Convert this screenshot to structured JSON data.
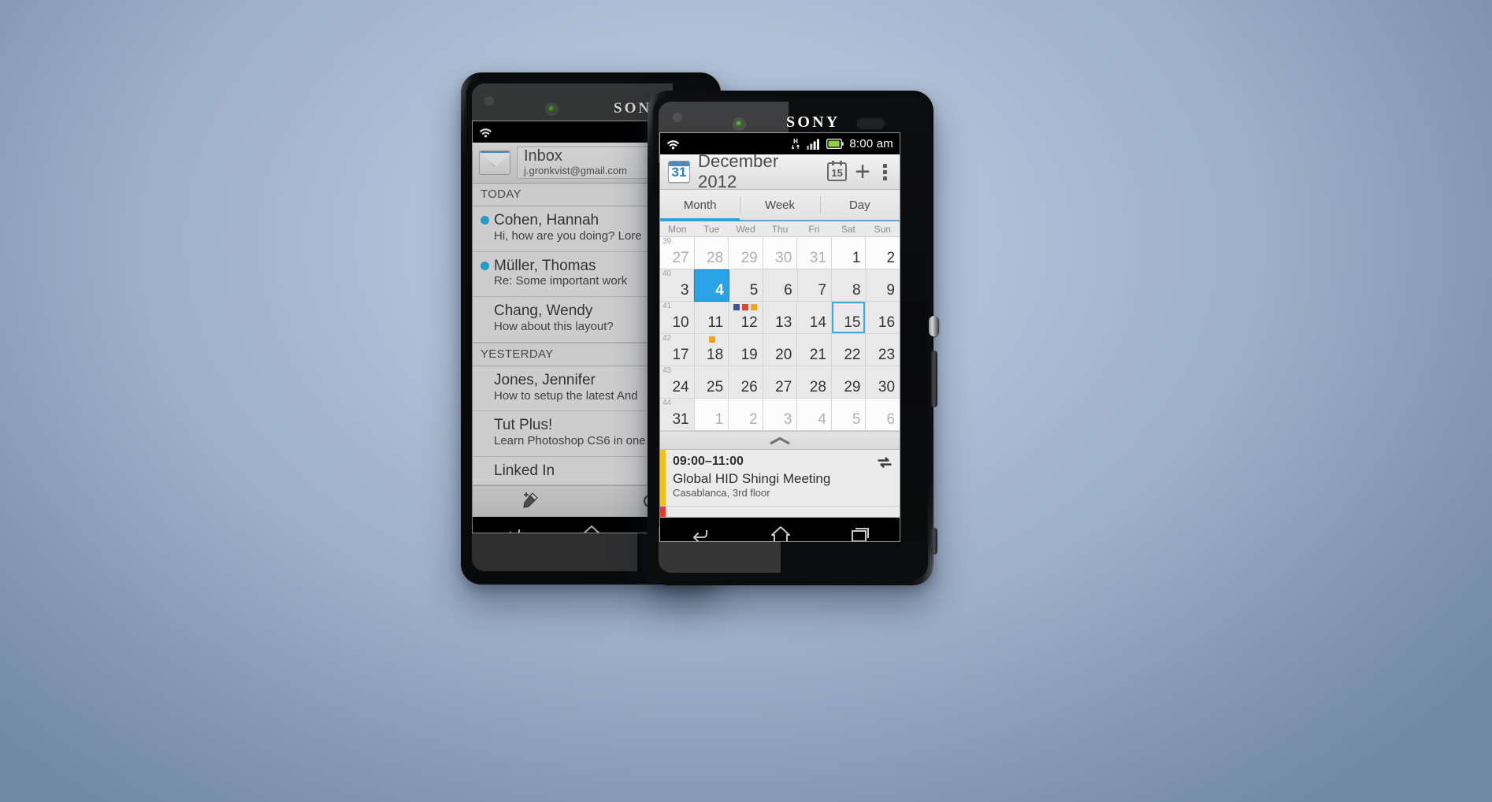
{
  "background": {
    "color_center": "#b6c6dc",
    "color_edge": "#7289a5"
  },
  "brand": {
    "logo": "SONY"
  },
  "mail_phone": {
    "statusbar": {
      "wifi_icon": "wifi-icon"
    },
    "header": {
      "icon": "mail-icon",
      "title": "Inbox",
      "account": "j.gronkvist@gmail.com"
    },
    "sections": [
      {
        "label": "TODAY",
        "rows": [
          {
            "from": "Cohen, Hannah",
            "snippet": "Hi, how are you doing? Lore",
            "unread": true
          },
          {
            "from": "Müller, Thomas",
            "snippet": "Re: Some important work",
            "unread": true
          },
          {
            "from": "Chang, Wendy",
            "snippet": "How about this layout?",
            "unread": false
          }
        ]
      },
      {
        "label": "YESTERDAY",
        "rows": [
          {
            "from": "Jones, Jennifer",
            "snippet": "How to setup the latest And",
            "unread": false
          },
          {
            "from": "Tut Plus!",
            "snippet": "Learn Photoshop CS6 in one",
            "unread": false
          },
          {
            "from": "Linked In",
            "snippet": "",
            "unread": false
          }
        ]
      }
    ],
    "toolbar": [
      {
        "name": "compose-button",
        "icon": "compose-pencil-icon"
      },
      {
        "name": "refresh-button",
        "icon": "refresh-icon"
      }
    ],
    "navbar": [
      {
        "name": "back-button",
        "icon": "back-arrow-icon"
      },
      {
        "name": "home-button",
        "icon": "home-icon"
      }
    ]
  },
  "calendar_phone": {
    "statusbar": {
      "wifi_icon": "wifi-icon",
      "data_icon": "hsdpa-data-icon",
      "data_label": "H",
      "signal_icon": "signal-bars-icon",
      "battery_icon": "battery-icon",
      "time": "8:00 am"
    },
    "actionbar": {
      "app_icon_label": "31",
      "title": "December 2012",
      "goto_today_label": "15",
      "add_label": "+",
      "overflow": "overflow-menu-icon"
    },
    "tabs": [
      {
        "label": "Month",
        "active": true
      },
      {
        "label": "Week",
        "active": false
      },
      {
        "label": "Day",
        "active": false
      }
    ],
    "day_headers": [
      "Mon",
      "Tue",
      "Wed",
      "Thu",
      "Fri",
      "Sat",
      "Sun"
    ],
    "weeks": [
      {
        "week_number": "39",
        "days": [
          {
            "n": "27",
            "muted": true,
            "white": true
          },
          {
            "n": "28",
            "muted": true,
            "white": true
          },
          {
            "n": "29",
            "muted": true,
            "white": true
          },
          {
            "n": "30",
            "muted": true,
            "white": true
          },
          {
            "n": "31",
            "muted": true,
            "white": true
          },
          {
            "n": "1",
            "muted": false,
            "white": true
          },
          {
            "n": "2",
            "muted": false,
            "white": true
          }
        ]
      },
      {
        "week_number": "40",
        "days": [
          {
            "n": "3",
            "muted": false
          },
          {
            "n": "4",
            "muted": false,
            "selected": true
          },
          {
            "n": "5",
            "muted": false
          },
          {
            "n": "6",
            "muted": false
          },
          {
            "n": "7",
            "muted": false
          },
          {
            "n": "8",
            "muted": false
          },
          {
            "n": "9",
            "muted": false
          }
        ]
      },
      {
        "week_number": "41",
        "days": [
          {
            "n": "10",
            "muted": false
          },
          {
            "n": "11",
            "muted": false
          },
          {
            "n": "12",
            "muted": false,
            "dots": [
              "#3b55a0",
              "#e4452c",
              "#f4a21c"
            ]
          },
          {
            "n": "13",
            "muted": false
          },
          {
            "n": "14",
            "muted": false
          },
          {
            "n": "15",
            "muted": false,
            "today": true
          },
          {
            "n": "16",
            "muted": false
          }
        ]
      },
      {
        "week_number": "42",
        "days": [
          {
            "n": "17",
            "muted": false
          },
          {
            "n": "18",
            "muted": false,
            "dots_left": [
              "#f4a21c"
            ]
          },
          {
            "n": "19",
            "muted": false
          },
          {
            "n": "20",
            "muted": false
          },
          {
            "n": "21",
            "muted": false
          },
          {
            "n": "22",
            "muted": false
          },
          {
            "n": "23",
            "muted": false
          }
        ]
      },
      {
        "week_number": "43",
        "days": [
          {
            "n": "24",
            "muted": false
          },
          {
            "n": "25",
            "muted": false
          },
          {
            "n": "26",
            "muted": false
          },
          {
            "n": "27",
            "muted": false
          },
          {
            "n": "28",
            "muted": false
          },
          {
            "n": "29",
            "muted": false
          },
          {
            "n": "30",
            "muted": false
          }
        ]
      },
      {
        "week_number": "44",
        "days": [
          {
            "n": "31",
            "muted": false
          },
          {
            "n": "1",
            "muted": true,
            "white": true
          },
          {
            "n": "2",
            "muted": true,
            "white": true
          },
          {
            "n": "3",
            "muted": true,
            "white": true
          },
          {
            "n": "4",
            "muted": true,
            "white": true
          },
          {
            "n": "5",
            "muted": true,
            "white": true
          },
          {
            "n": "6",
            "muted": true,
            "white": true
          }
        ]
      }
    ],
    "agenda_handle": {
      "icon": "chevron-up-icon"
    },
    "events": [
      {
        "time": "09:00–11:00",
        "title": "Global HID Shingi Meeting",
        "location": "Casablanca, 3rd floor",
        "bar_color": "#f2c11c",
        "repeat_icon": "repeat-icon"
      },
      {
        "time": "",
        "title": "",
        "location": "",
        "bar_color": "#e03c2a",
        "repeat_icon": ""
      }
    ],
    "navbar": [
      {
        "name": "back-button",
        "icon": "back-arrow-icon"
      },
      {
        "name": "home-button",
        "icon": "home-icon"
      },
      {
        "name": "recents-button",
        "icon": "recents-icon"
      }
    ]
  }
}
